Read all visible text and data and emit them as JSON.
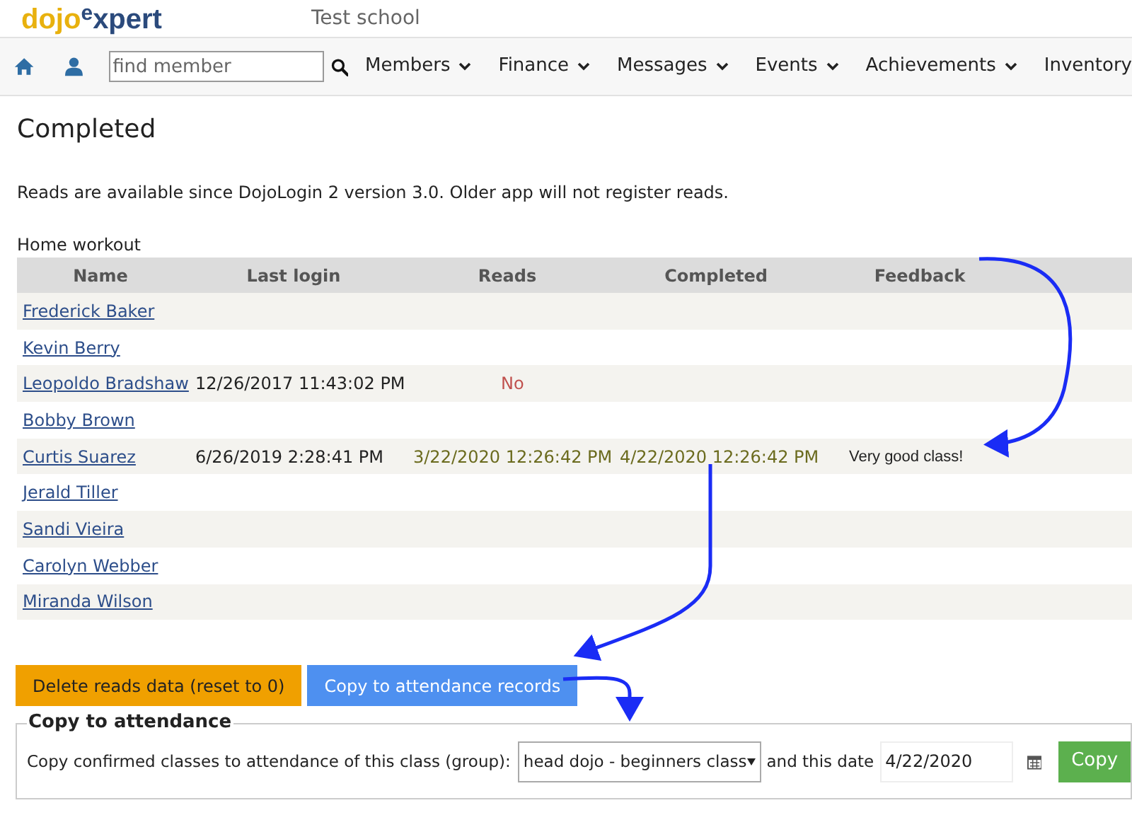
{
  "brand": {
    "part1": "dojo",
    "part2": "e",
    "part3": "xpert"
  },
  "school": "Test school",
  "nav": {
    "search_placeholder": "find member",
    "menus": [
      {
        "label": "Members",
        "dropdown": true
      },
      {
        "label": "Finance",
        "dropdown": true
      },
      {
        "label": "Messages",
        "dropdown": true
      },
      {
        "label": "Events",
        "dropdown": true
      },
      {
        "label": "Achievements",
        "dropdown": true
      },
      {
        "label": "Inventory",
        "dropdown": false
      }
    ]
  },
  "page_title": "Completed",
  "notice": "Reads are available since DojoLogin 2 version 3.0. Older app will not register reads.",
  "table": {
    "caption": "Home workout",
    "columns": [
      "Name",
      "Last login",
      "Reads",
      "Completed",
      "Feedback"
    ],
    "rows": [
      {
        "name": "Frederick Baker"
      },
      {
        "name": "Kevin Berry"
      },
      {
        "name": "Leopoldo Bradshaw",
        "last_login": "12/26/2017 11:43:02 PM",
        "reads": {
          "text": "No",
          "kind": "no"
        }
      },
      {
        "name": "Bobby Brown"
      },
      {
        "name": "Curtis Suarez",
        "last_login": "6/26/2019 2:28:41 PM",
        "reads": {
          "text": "3/22/2020 12:26:42 PM",
          "kind": "date"
        },
        "completed": "4/22/2020 12:26:42 PM",
        "feedback": "Very good class!"
      },
      {
        "name": "Jerald Tiller"
      },
      {
        "name": "Sandi Vieira"
      },
      {
        "name": "Carolyn Webber"
      },
      {
        "name": "Miranda Wilson"
      }
    ]
  },
  "buttons": {
    "delete": "Delete reads data (reset to 0)",
    "copy_records": "Copy to attendance records"
  },
  "copy_section": {
    "legend": "Copy to attendance",
    "label": "Copy confirmed classes to attendance of this class (group):",
    "class_value": "head dojo - beginners class",
    "date_label": "and this date",
    "date_value": "4/22/2020",
    "button": "Copy"
  }
}
